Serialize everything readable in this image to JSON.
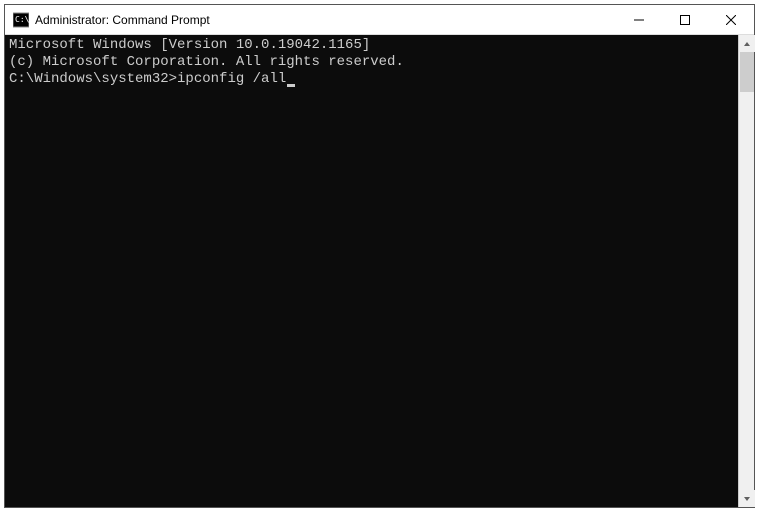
{
  "window": {
    "title": "Administrator: Command Prompt"
  },
  "terminal": {
    "line1": "Microsoft Windows [Version 10.0.19042.1165]",
    "line2": "(c) Microsoft Corporation. All rights reserved.",
    "blank": "",
    "prompt": "C:\\Windows\\system32>",
    "command": "ipconfig /all"
  }
}
